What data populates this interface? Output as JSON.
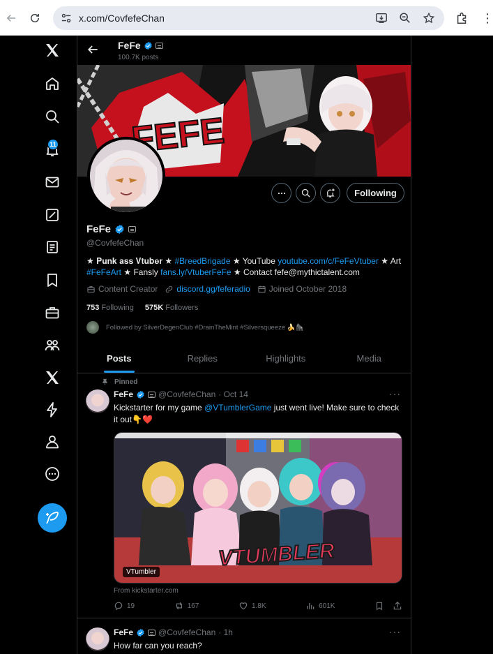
{
  "browser": {
    "url": "x.com/CovfefeChan",
    "icons": [
      "back-arrow-icon",
      "reload-icon",
      "site-settings-icon",
      "install-icon",
      "zoom-icon",
      "star-icon",
      "extensions-icon",
      "menu-icon"
    ]
  },
  "leftnav": {
    "items": [
      "x-logo",
      "home",
      "explore",
      "notifications",
      "messages",
      "grok",
      "lists",
      "bookmarks",
      "jobs",
      "communities",
      "premium",
      "verified-orgs",
      "profile",
      "more"
    ],
    "notification_count": "11",
    "post_button": "post-icon"
  },
  "header": {
    "name": "FeFe",
    "post_count": "100.7K posts"
  },
  "profile": {
    "banner_text": "FEFE",
    "name": "FeFe",
    "handle": "@CovfefeChan",
    "following_label": "Following",
    "bio": {
      "part1": "★ 𝐏𝐮𝐧𝐤 𝐚𝐬𝐬 𝐕𝐭𝐮𝐛𝐞𝐫 ★ ",
      "hashtag1": "#BreedBrigade",
      "part2": " ★ YouTube ",
      "youtube": "youtube.com/c/FeFeVtuber",
      "part3": " ★ Art ",
      "hashtag2": "#FeFeArt",
      "part4": " ★ Fansly ",
      "fansly": "fans.ly/VtuberFeFe",
      "part5": " ★ Contact fefe@mythictalent.com"
    },
    "category": "Content Creator",
    "website": "discord.gg/feferadio",
    "joined": "Joined October 2018",
    "following_count": "753",
    "following_text": "Following",
    "followers_count": "575K",
    "followers_text": "Followers",
    "followed_by": "Followed by SilverDegenClub #DrainTheMint #Silversqueeze 🍌🦍"
  },
  "tabs": [
    {
      "label": "Posts",
      "active": true
    },
    {
      "label": "Replies",
      "active": false
    },
    {
      "label": "Highlights",
      "active": false
    },
    {
      "label": "Media",
      "active": false
    }
  ],
  "tweets": [
    {
      "pinned_label": "Pinned",
      "name": "FeFe",
      "handle": "@CovfefeChan",
      "time": "· Oct 14",
      "text_before": "Kickstarter for my game ",
      "mention": "@VTumblerGame",
      "text_after": " just went live! Make sure to check it out👇❤️",
      "media_label": "VTumbler",
      "media_title": "VTUMBLER",
      "from": "From kickstarter.com",
      "replies": "19",
      "reposts": "167",
      "likes": "1.8K",
      "views": "601K"
    },
    {
      "name": "FeFe",
      "handle": "@CovfefeChan",
      "time": "· 1h",
      "text": "How far can you reach?"
    }
  ],
  "colors": {
    "accent": "#1d9bf0",
    "background": "#000000",
    "text": "#e7e9ea",
    "muted": "#71767b",
    "border": "#2f3336"
  }
}
